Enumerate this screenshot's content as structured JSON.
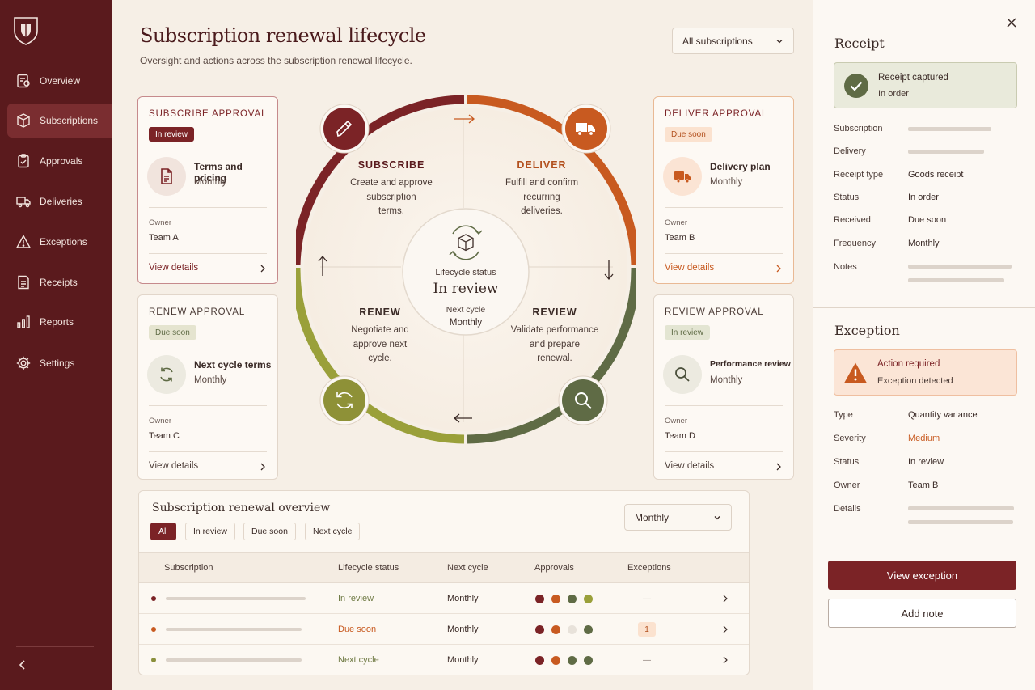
{
  "colors": {
    "crimson": "#7b2326",
    "orange": "#c85a20",
    "olive": "#9aa03a",
    "sage": "#5f6b45",
    "sidebar": "#5a1a1d"
  },
  "sidebar": {
    "items": [
      {
        "label": "Overview",
        "icon": "overview-icon"
      },
      {
        "label": "Subscriptions",
        "icon": "box-icon",
        "active": true
      },
      {
        "label": "Approvals",
        "icon": "clipboard-check-icon"
      },
      {
        "label": "Deliveries",
        "icon": "truck-icon"
      },
      {
        "label": "Exceptions",
        "icon": "warning-icon"
      },
      {
        "label": "Receipts",
        "icon": "receipt-icon"
      },
      {
        "label": "Reports",
        "icon": "bar-chart-icon"
      },
      {
        "label": "Settings",
        "icon": "gear-icon"
      }
    ]
  },
  "header": {
    "title": "Subscription renewal lifecycle",
    "subtitle": "Oversight and actions across the subscription renewal lifecycle.",
    "filter": "All subscriptions"
  },
  "cards": {
    "subscribe": {
      "title": "SUBSCRIBE APPROVAL",
      "badge": "In review",
      "head": "Terms and pricing",
      "sub": "Monthly",
      "owner_label": "Owner",
      "owner": "Team A",
      "link": "View details"
    },
    "renew": {
      "title": "RENEW APPROVAL",
      "badge": "Due soon",
      "head": "Next cycle terms",
      "sub": "Monthly",
      "owner_label": "Owner",
      "owner": "Team C",
      "link": "View details"
    },
    "deliver": {
      "title": "DELIVER APPROVAL",
      "badge": "Due soon",
      "head": "Delivery plan",
      "sub": "Monthly",
      "owner_label": "Owner",
      "owner": "Team B",
      "link": "View details"
    },
    "review": {
      "title": "REVIEW APPROVAL",
      "badge": "In review",
      "head": "Performance review",
      "sub": "Monthly",
      "owner_label": "Owner",
      "owner": "Team D",
      "link": "View details"
    }
  },
  "cycle": {
    "subscribe": {
      "title": "SUBSCRIBE",
      "lines": [
        "Create and approve",
        "subscription",
        "terms."
      ]
    },
    "deliver": {
      "title": "DELIVER",
      "lines": [
        "Fulfill and confirm",
        "recurring",
        "deliveries."
      ]
    },
    "renew": {
      "title": "RENEW",
      "lines": [
        "Negotiate and",
        "approve next",
        "cycle."
      ]
    },
    "review": {
      "title": "REVIEW",
      "lines": [
        "Validate performance",
        "and prepare",
        "renewal."
      ]
    },
    "center": {
      "label": "Lifecycle status",
      "status": "In review",
      "next_label": "Next cycle",
      "next_value": "Monthly"
    }
  },
  "overview": {
    "title": "Subscription renewal overview",
    "period": "Monthly",
    "chips": [
      "All",
      "In review",
      "Due soon",
      "Next cycle"
    ],
    "columns": [
      "Subscription",
      "Lifecycle status",
      "Next cycle",
      "Approvals",
      "Exceptions"
    ],
    "rows": [
      {
        "status": "In review",
        "status_color": "#6f7a44",
        "dot": "#7b2326",
        "next": "Monthly",
        "approvals": [
          "#7b2326",
          "#c85a20",
          "#5f6b45",
          "#9aa03a"
        ],
        "exceptions": "—"
      },
      {
        "status": "Due soon",
        "status_color": "#c85a20",
        "dot": "#c85a20",
        "next": "Monthly",
        "approvals": [
          "#7b2326",
          "#c85a20",
          "#e8e2da",
          "#5f6b45"
        ],
        "exceptions": "1"
      },
      {
        "status": "Next cycle",
        "status_color": "#6f7a44",
        "dot": "#8a8f3c",
        "next": "Monthly",
        "approvals": [
          "#7b2326",
          "#c85a20",
          "#5f6b45",
          "#5f6b45"
        ],
        "exceptions": "—"
      }
    ]
  },
  "receipt": {
    "heading": "Receipt",
    "banner_title": "Receipt captured",
    "banner_sub": "In order",
    "fields": {
      "subscription_label": "Subscription",
      "delivery_label": "Delivery",
      "type_label": "Receipt type",
      "type_value": "Goods receipt",
      "status_label": "Status",
      "status_value": "In order",
      "received_label": "Received",
      "received_value": "Due soon",
      "frequency_label": "Frequency",
      "frequency_value": "Monthly",
      "notes_label": "Notes"
    }
  },
  "exception": {
    "heading": "Exception",
    "banner_title": "Action required",
    "banner_sub": "Exception detected",
    "fields": {
      "type_label": "Type",
      "type_value": "Quantity variance",
      "severity_label": "Severity",
      "severity_value": "Medium",
      "status_label": "Status",
      "status_value": "In review",
      "owner_label": "Owner",
      "owner_value": "Team B",
      "details_label": "Details"
    },
    "primary_button": "View exception",
    "secondary_button": "Add note"
  }
}
